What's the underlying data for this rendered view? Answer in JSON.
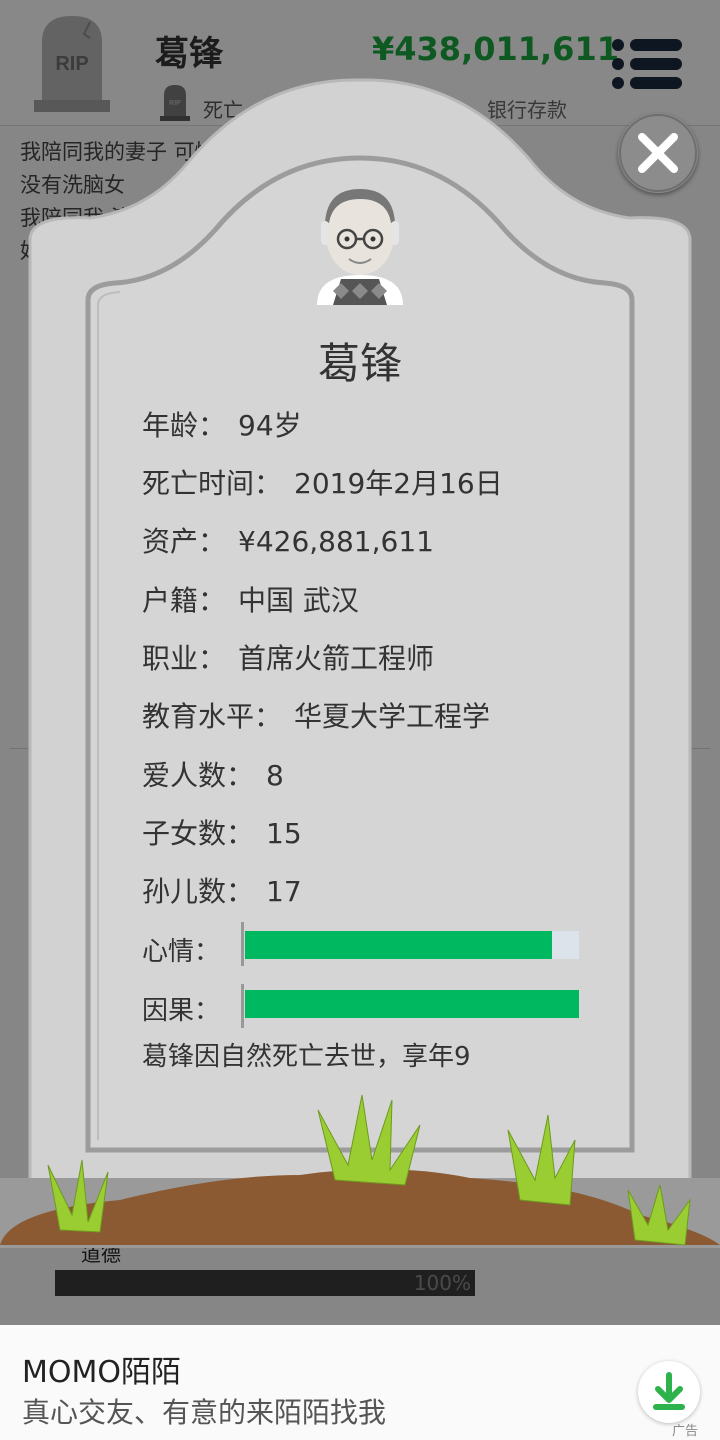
{
  "header": {
    "name": "葛锋",
    "status": "死亡",
    "money": "¥438,011,611",
    "money_label": "银行存款",
    "rip_text": "RIP"
  },
  "log_lines": [
    "我陪同我的妻子                         可惜这",
    "没有洗脑女",
    "我陪同我                                  演可真",
    "好"
  ],
  "dialog": {
    "name": "葛锋",
    "fields": [
      {
        "label": "年龄：",
        "value": "94岁"
      },
      {
        "label": "死亡时间：",
        "value": "2019年2月16日"
      },
      {
        "label": "资产：",
        "value": "¥426,881,611"
      },
      {
        "label": "户籍：",
        "value": "中国 武汉"
      },
      {
        "label": "职业：",
        "value": "首席火箭工程师"
      },
      {
        "label": "教育水平：",
        "value": "华夏大学工程学"
      },
      {
        "label": "爱人数：",
        "value": "8"
      },
      {
        "label": "子女数：",
        "value": "15"
      },
      {
        "label": "孙儿数：",
        "value": "17"
      }
    ],
    "mood_label": "心情：",
    "mood_level": 0.92,
    "karma_label": "因果：",
    "karma_level": 1.0,
    "epitaph": "葛锋因自然死亡去世，享年9"
  },
  "morality": {
    "label": "道德",
    "percent": "100%"
  },
  "ad": {
    "title": "MOMO陌陌",
    "subtitle": "真心交友、有意的来陌陌找我",
    "badge": "广告"
  },
  "colors": {
    "money": "#19a33c",
    "bar": "#00b860",
    "stone": "#d2d2d2",
    "dirt": "#8b5a32",
    "grass": "#9acd32"
  },
  "icons": {
    "close": "close-icon",
    "menu": "menu-icon",
    "download": "download-icon",
    "tombstone": "tombstone-icon"
  }
}
